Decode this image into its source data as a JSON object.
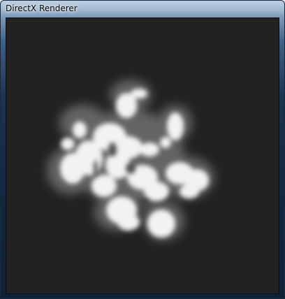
{
  "window": {
    "title": "DirectX Renderer"
  },
  "viewport": {
    "background": "#222222",
    "content": "soft white metaball particle cluster"
  }
}
